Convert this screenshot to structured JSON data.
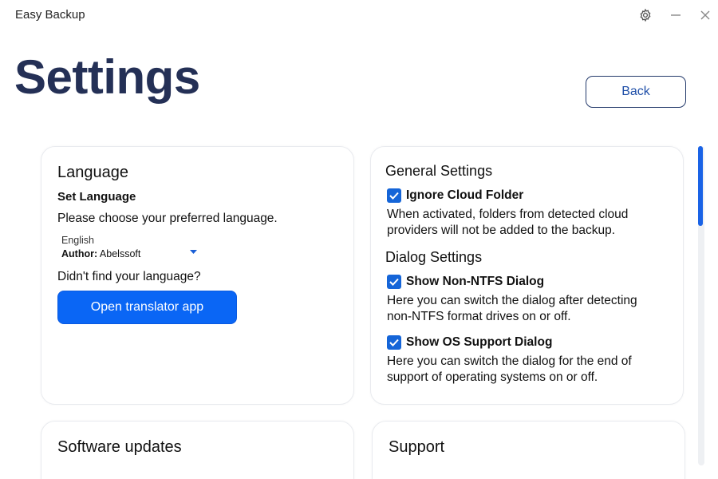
{
  "window": {
    "title": "Easy Backup",
    "buttons": [
      "gear-icon",
      "minimize-icon",
      "close-icon"
    ]
  },
  "page": {
    "title": "Settings",
    "back_label": "Back"
  },
  "language": {
    "heading": "Language",
    "subheading": "Set Language",
    "prompt": "Please choose your preferred language.",
    "selected": "English",
    "author_label": "Author:",
    "author_value": "Abelssoft",
    "not_found": "Didn't find your language?",
    "translator_button": "Open translator app"
  },
  "general": {
    "heading": "General Settings",
    "ignore_cloud": {
      "label": "Ignore Cloud Folder",
      "checked": true,
      "desc_line1": "When activated, folders from detected cloud",
      "desc_line2": "providers will not be added to the backup."
    },
    "dialog_heading": "Dialog Settings",
    "non_ntfs": {
      "label": "Show Non-NTFS Dialog",
      "checked": true,
      "desc_line1": "Here you can switch the dialog after detecting",
      "desc_line2": "non-NTFS format drives on or off."
    },
    "os_support": {
      "label": "Show OS Support Dialog",
      "checked": true,
      "desc_line1": "Here you can switch the dialog for the end of",
      "desc_line2": "support of operating systems on or off."
    }
  },
  "updates": {
    "heading": "Software updates"
  },
  "support": {
    "heading": "Support"
  },
  "colors": {
    "title": "#243056",
    "primary": "#0a66f5",
    "checkbox": "#1565d8",
    "scroll_thumb": "#1a63e6"
  }
}
